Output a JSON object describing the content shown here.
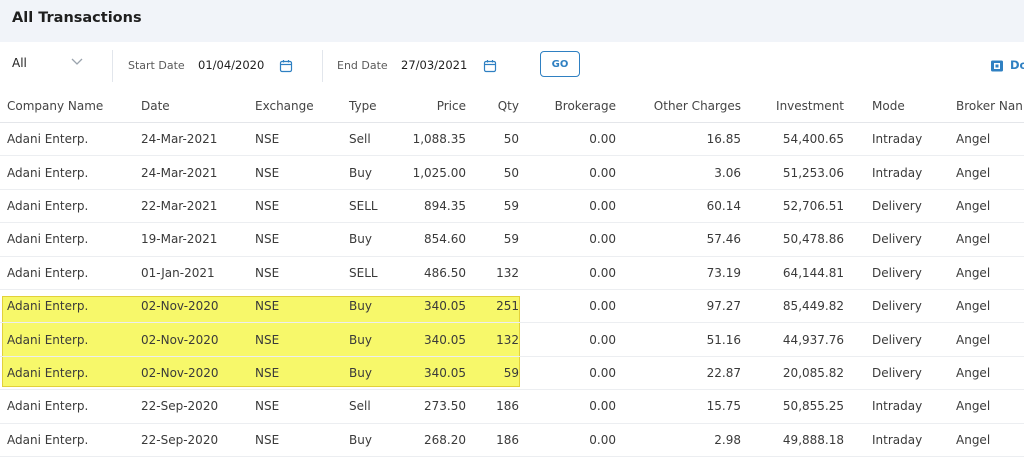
{
  "header": {
    "title": "All Transactions"
  },
  "filters": {
    "period_value": "All",
    "start_label": "Start Date",
    "start_value": "01/04/2020",
    "end_label": "End Date",
    "end_value": "27/03/2021",
    "go_label": "GO",
    "download_label": "Do"
  },
  "table": {
    "columns": [
      "Company Name",
      "Date",
      "Exchange",
      "Type",
      "Price",
      "Qty",
      "Brokerage",
      "Other Charges",
      "Investment",
      "Mode",
      "Broker Nan"
    ],
    "rows": [
      [
        "Adani Enterp.",
        "24-Mar-2021",
        "NSE",
        "Sell",
        "1,088.35",
        "50",
        "0.00",
        "16.85",
        "54,400.65",
        "Intraday",
        "Angel"
      ],
      [
        "Adani Enterp.",
        "24-Mar-2021",
        "NSE",
        "Buy",
        "1,025.00",
        "50",
        "0.00",
        "3.06",
        "51,253.06",
        "Intraday",
        "Angel"
      ],
      [
        "Adani Enterp.",
        "22-Mar-2021",
        "NSE",
        "SELL",
        "894.35",
        "59",
        "0.00",
        "60.14",
        "52,706.51",
        "Delivery",
        "Angel"
      ],
      [
        "Adani Enterp.",
        "19-Mar-2021",
        "NSE",
        "Buy",
        "854.60",
        "59",
        "0.00",
        "57.46",
        "50,478.86",
        "Delivery",
        "Angel"
      ],
      [
        "Adani Enterp.",
        "01-Jan-2021",
        "NSE",
        "SELL",
        "486.50",
        "132",
        "0.00",
        "73.19",
        "64,144.81",
        "Delivery",
        "Angel"
      ],
      [
        "Adani Enterp.",
        "02-Nov-2020",
        "NSE",
        "Buy",
        "340.05",
        "251",
        "0.00",
        "97.27",
        "85,449.82",
        "Delivery",
        "Angel"
      ],
      [
        "Adani Enterp.",
        "02-Nov-2020",
        "NSE",
        "Buy",
        "340.05",
        "132",
        "0.00",
        "51.16",
        "44,937.76",
        "Delivery",
        "Angel"
      ],
      [
        "Adani Enterp.",
        "02-Nov-2020",
        "NSE",
        "Buy",
        "340.05",
        "59",
        "0.00",
        "22.87",
        "20,085.82",
        "Delivery",
        "Angel"
      ],
      [
        "Adani Enterp.",
        "22-Sep-2020",
        "NSE",
        "Sell",
        "273.50",
        "186",
        "0.00",
        "15.75",
        "50,855.25",
        "Intraday",
        "Angel"
      ],
      [
        "Adani Enterp.",
        "22-Sep-2020",
        "NSE",
        "Buy",
        "268.20",
        "186",
        "0.00",
        "2.98",
        "49,888.18",
        "Intraday",
        "Angel"
      ]
    ]
  },
  "colors": {
    "accent": "#2f80c2",
    "highlight": "#f7f86a",
    "header_bg": "#f1f4f9"
  },
  "icons": [
    "chevron-down-icon",
    "calendar-icon",
    "download-icon"
  ]
}
